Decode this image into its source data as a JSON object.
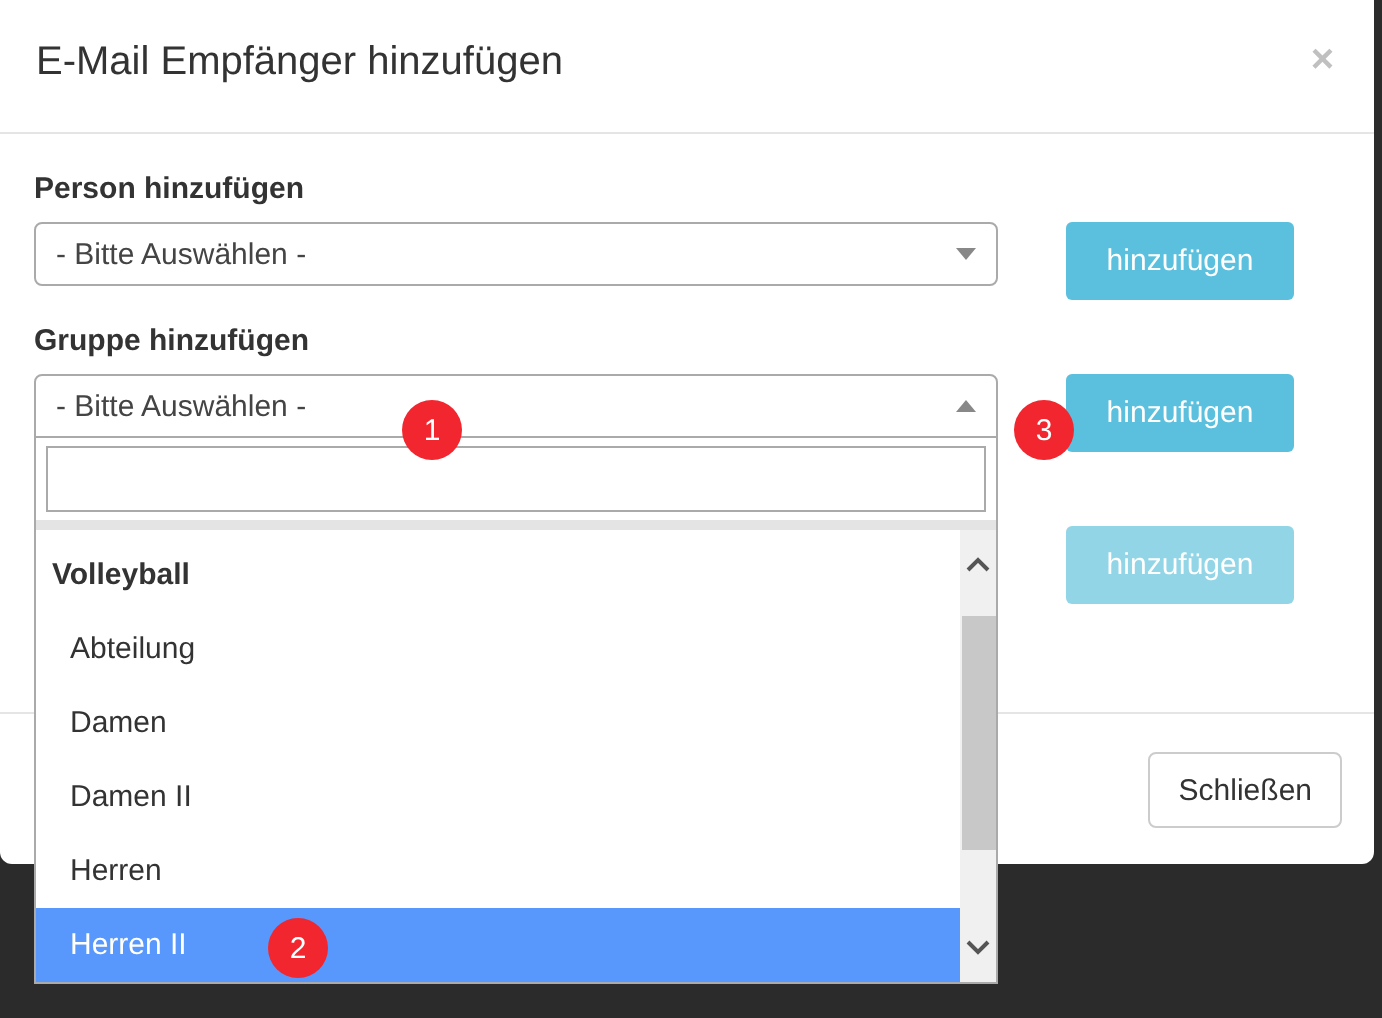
{
  "dialog": {
    "title": "E-Mail Empfänger hinzufügen",
    "close": "×"
  },
  "rows": [
    {
      "label": "Person hinzufügen",
      "select": {
        "value": "- Bitte Auswählen -",
        "expanded": false
      },
      "button": {
        "label": "hinzufügen",
        "disabled": false
      }
    },
    {
      "label": "Gruppe hinzufügen",
      "select": {
        "value": "- Bitte Auswählen -",
        "expanded": true
      },
      "button": {
        "label": "hinzufügen",
        "disabled": false
      }
    },
    {
      "button": {
        "label": "hinzufügen",
        "disabled": true
      }
    }
  ],
  "dropdown": {
    "group": "Volleyball",
    "options": [
      {
        "label": "Abteilung",
        "selected": false
      },
      {
        "label": "Damen",
        "selected": false
      },
      {
        "label": "Damen II",
        "selected": false
      },
      {
        "label": "Herren",
        "selected": false
      },
      {
        "label": "Herren II",
        "selected": true
      }
    ]
  },
  "annotations": [
    {
      "label": "1"
    },
    {
      "label": "2"
    },
    {
      "label": "3"
    }
  ],
  "footer": {
    "close_button": "Schließen"
  }
}
